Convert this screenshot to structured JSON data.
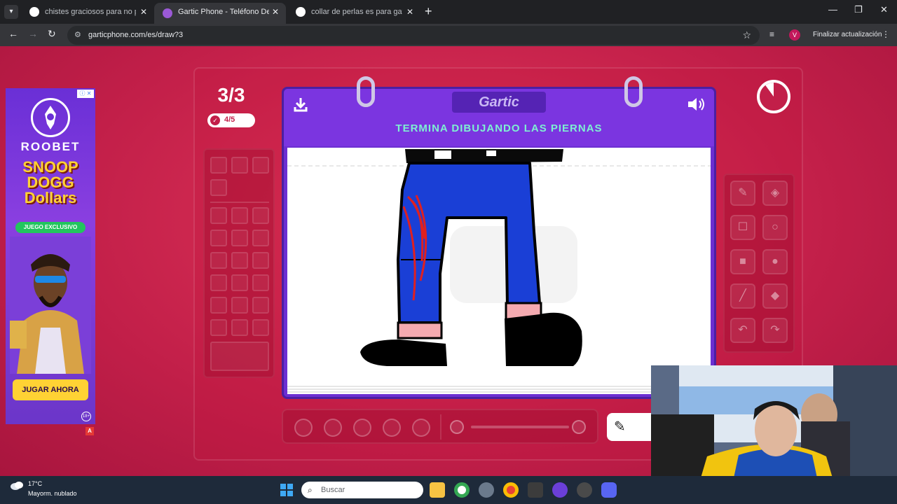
{
  "browser": {
    "tabs": [
      {
        "title": "chistes graciosos para no parar",
        "active": false,
        "favicon": "google-icon"
      },
      {
        "title": "Gartic Phone - Teléfono Descon",
        "active": true,
        "favicon": "gartic-phone-icon"
      },
      {
        "title": "collar de perlas es para gays no",
        "active": false,
        "favicon": "google-icon"
      }
    ],
    "url": "garticphone.com/es/draw?3",
    "avatar_letter": "V",
    "update_label": "Finalizar actualización",
    "tab_close": "✕",
    "new_tab": "+"
  },
  "ad": {
    "brand": "ROOBET",
    "game_title": "SNOOP DOGG Dollars",
    "exclusive": "JUEGO EXCLUSIVO",
    "cta": "JUGAR AHORA",
    "age": "18+",
    "info": "ⓘ ✕",
    "badge": "A"
  },
  "game": {
    "round": "3/3",
    "progress": "4/5",
    "logo": "Gartic",
    "prompt": "TERMINA DIBUJANDO LAS PIERNAS",
    "timer_remaining_fraction": 0.1,
    "accent": "#7b35e0",
    "prompt_color": "#7ef0d2"
  },
  "tools": [
    "pencil-icon",
    "eraser-icon",
    "rectangle-outline-icon",
    "circle-outline-icon",
    "rectangle-filled-icon",
    "circle-filled-icon",
    "line-icon",
    "fill-bucket-icon",
    "undo-icon",
    "redo-icon"
  ],
  "taskbar": {
    "temperature": "17°C",
    "weather": "Mayorm. nublado",
    "search_placeholder": "Buscar"
  }
}
